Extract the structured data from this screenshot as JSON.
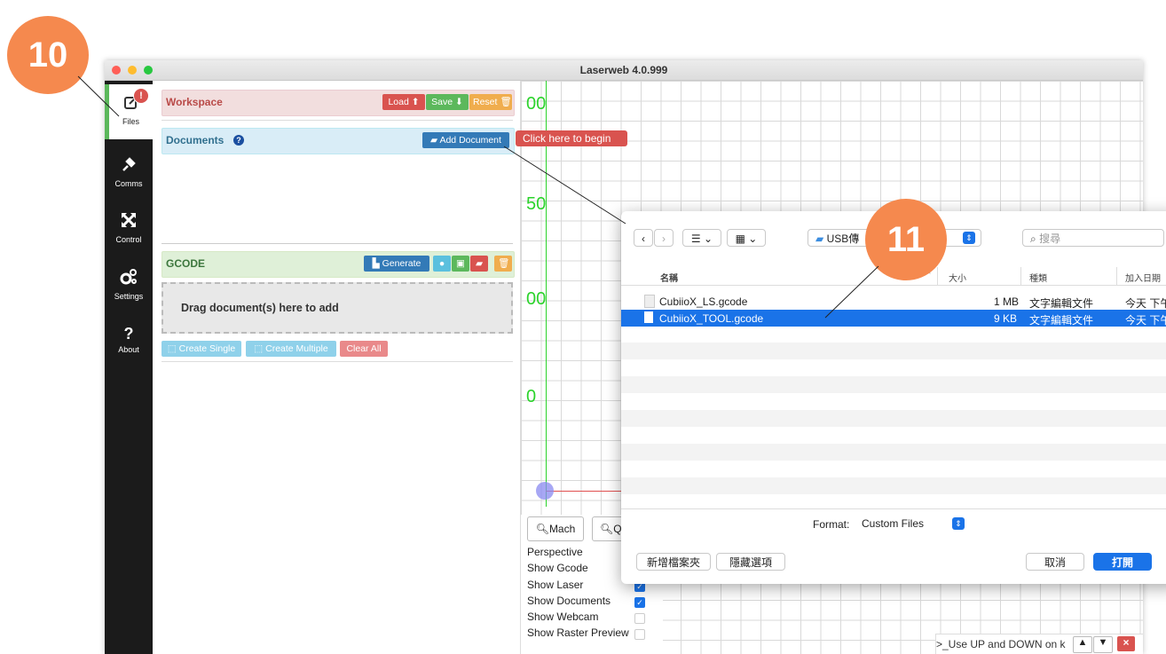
{
  "window": {
    "title": "Laserweb 4.0.999"
  },
  "callouts": {
    "step10": "10",
    "step11": "11"
  },
  "sidebar": {
    "items": [
      {
        "label": "Files",
        "icon": "files-icon"
      },
      {
        "label": "Comms",
        "icon": "plug-icon"
      },
      {
        "label": "Control",
        "icon": "arrows-icon"
      },
      {
        "label": "Settings",
        "icon": "gears-icon"
      },
      {
        "label": "About",
        "icon": "question-icon"
      }
    ],
    "files_badge": "!"
  },
  "workspace": {
    "title": "Workspace",
    "load": "Load",
    "save": "Save",
    "reset": "Reset"
  },
  "documents": {
    "title": "Documents",
    "help_icon": "?",
    "add_document": "Add Document",
    "tooltip": "Click here to begin"
  },
  "gcode": {
    "title": "GCODE",
    "generate": "Generate",
    "dropzone": "Drag document(s) here to add",
    "create_single": "Create Single",
    "create_multiple": "Create Multiple",
    "clear_all": "Clear All"
  },
  "canvas": {
    "axis_labels": [
      "00",
      "50",
      "00",
      "0"
    ]
  },
  "view_buttons": {
    "mach": "Mach",
    "second": "Q"
  },
  "options": {
    "rows": [
      {
        "label": "Perspective",
        "checked": null
      },
      {
        "label": "Show Gcode",
        "checked": null
      },
      {
        "label": "Show Laser",
        "checked": true
      },
      {
        "label": "Show Documents",
        "checked": true
      },
      {
        "label": "Show Webcam",
        "checked": false
      },
      {
        "label": "Show Raster Preview",
        "checked": false
      }
    ]
  },
  "console": {
    "hint": ">_Use UP and DOWN on k"
  },
  "dialog": {
    "location": "USB傳",
    "search_placeholder": "搜尋",
    "columns": {
      "name": "名稱",
      "size": "大小",
      "kind": "種類",
      "date_added": "加入日期"
    },
    "files": [
      {
        "name": "CubiioX_LS.gcode",
        "size": "1 MB",
        "kind": "文字編輯文件",
        "date": "今天 下午",
        "selected": false
      },
      {
        "name": "CubiioX_TOOL.gcode",
        "size": "9 KB",
        "kind": "文字編輯文件",
        "date": "今天 下午",
        "selected": true
      }
    ],
    "format_label": "Format:",
    "format_value": "Custom Files",
    "new_folder": "新增檔案夾",
    "hide_options": "隱藏選項",
    "cancel": "取消",
    "open": "打開"
  },
  "colors": {
    "accent": "#1a73e8",
    "callout": "#f5894e",
    "danger": "#d9534f",
    "success": "#5cb85c",
    "primary": "#337ab7",
    "warning": "#f0ad4e",
    "info": "#5bc0de"
  }
}
